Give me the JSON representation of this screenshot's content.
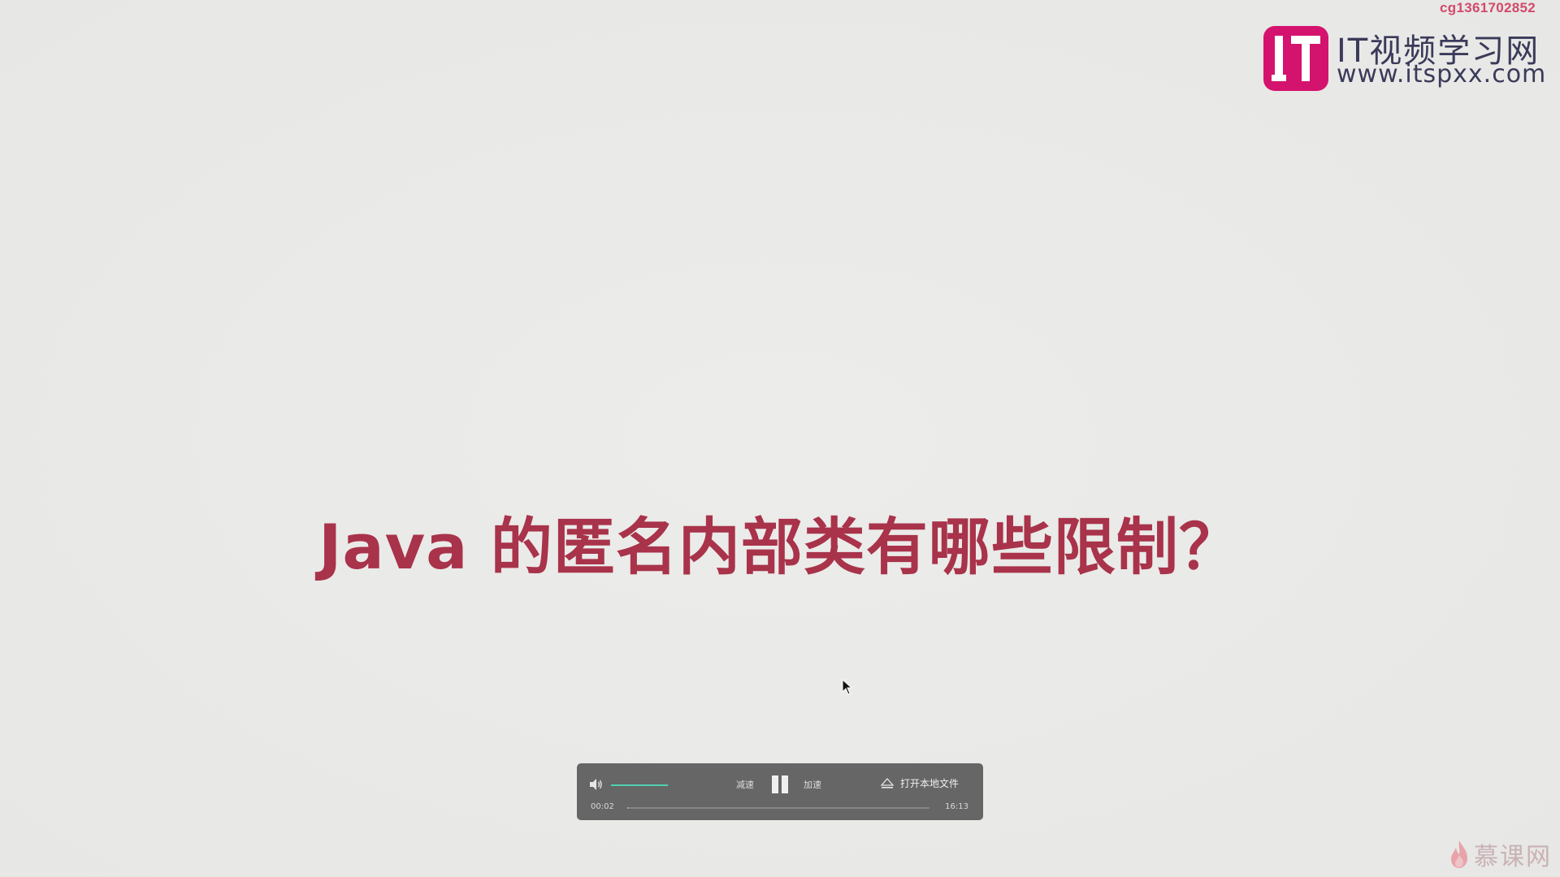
{
  "watermark": {
    "user_id": "cg1361702852",
    "logo_cn": "IT视频学习网",
    "logo_url": "www.itspxx.com",
    "bottom_brand": "慕课网"
  },
  "slide": {
    "title": "Java 的匿名内部类有哪些限制？"
  },
  "player": {
    "slow_label": "减速",
    "fast_label": "加速",
    "open_local_label": "打开本地文件",
    "time_current": "00:02",
    "time_total": "16:13",
    "volume_level": 1.0,
    "progress_fraction": 0.002
  },
  "colors": {
    "title": "#a8334a",
    "logo_magenta": "#d4136e",
    "volume_accent": "#4fd1b0"
  },
  "icons": {
    "volume": "speaker-icon",
    "pause": "pause-icon",
    "open": "eject-icon",
    "brand": "flame-icon",
    "cursor": "mouse-pointer-icon"
  }
}
